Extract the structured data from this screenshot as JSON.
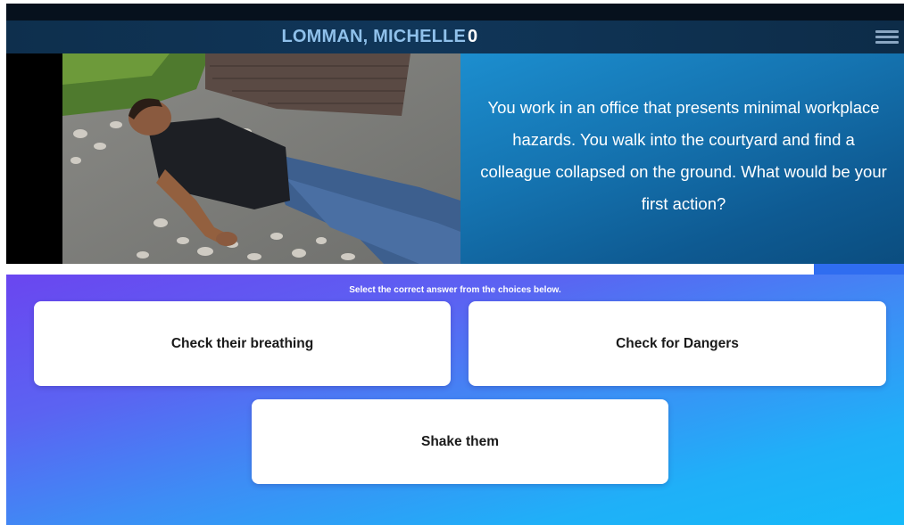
{
  "header": {
    "player_name": "LOMMAN, MICHELLE",
    "score": "0",
    "menu_icon": "hamburger-menu-icon"
  },
  "question": {
    "image_subject": "man lying collapsed on a stone courtyard path",
    "text": "You work in an office that presents minimal workplace hazards. You walk into the courtyard and find a colleague collapsed on the ground. What would be your first action?"
  },
  "progress": {
    "fraction": 0.9
  },
  "instruction": "Select the correct answer from the choices below.",
  "answers": [
    {
      "label": "Check their breathing"
    },
    {
      "label": "Check for Dangers"
    },
    {
      "label": "Shake them"
    }
  ],
  "colors": {
    "header_bg": "#103659",
    "player_name": "#8fc0ea",
    "question_panel": "#1574b1",
    "answers_gradient_start": "#6a46f0",
    "answers_gradient_end": "#15baf9"
  }
}
